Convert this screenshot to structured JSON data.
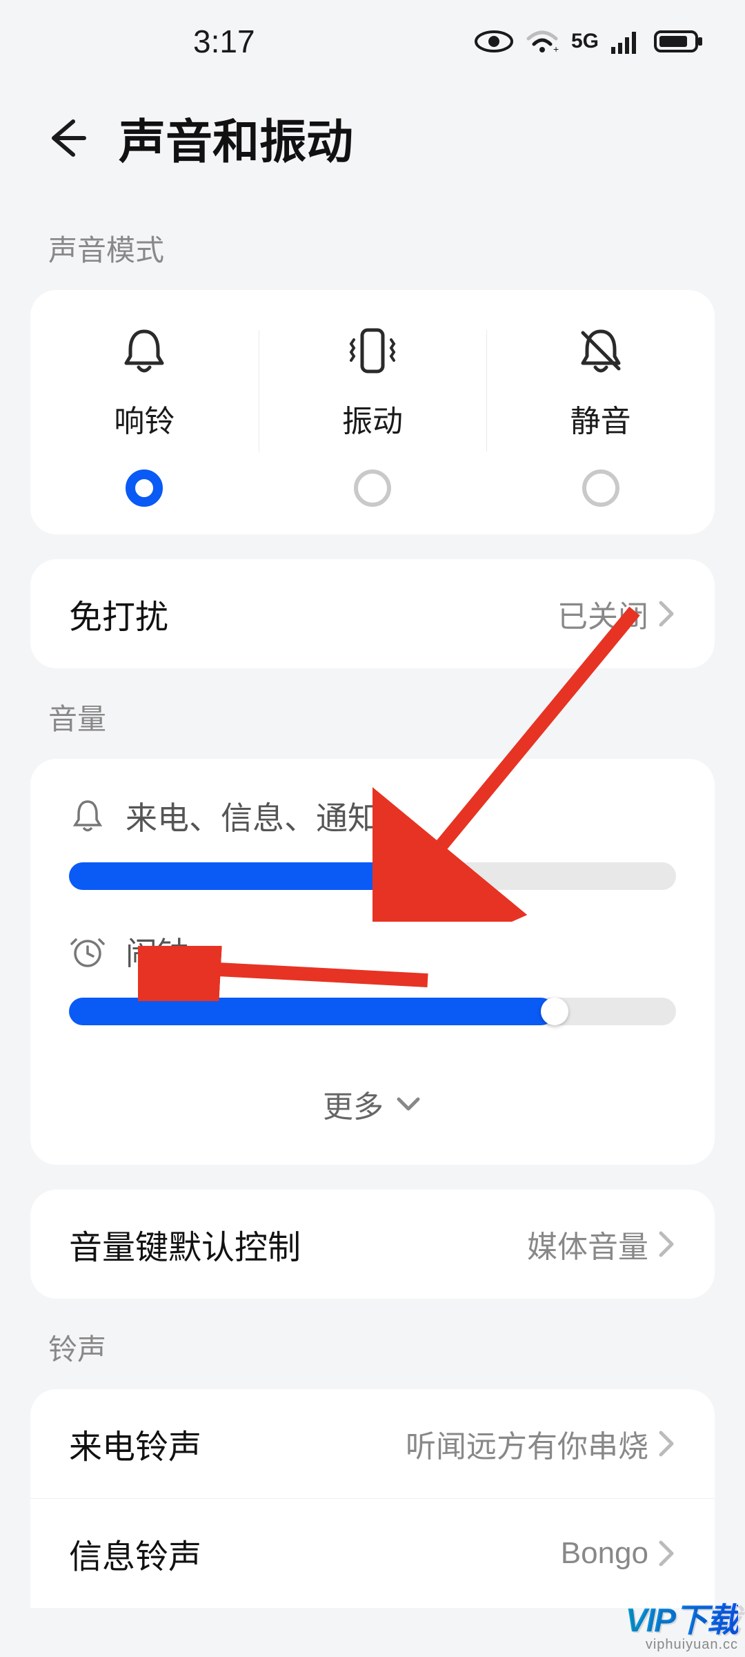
{
  "status": {
    "time": "3:17",
    "network": "5G"
  },
  "header": {
    "title": "声音和振动"
  },
  "sections": {
    "sound_mode_label": "声音模式",
    "volume_label": "音量",
    "ringtone_label": "铃声"
  },
  "sound_mode": {
    "options": [
      {
        "label": "响铃",
        "selected": true
      },
      {
        "label": "振动",
        "selected": false
      },
      {
        "label": "静音",
        "selected": false
      }
    ]
  },
  "dnd": {
    "title": "免打扰",
    "value": "已关闭"
  },
  "volume": {
    "sliders": [
      {
        "icon": "bell",
        "label": "来电、信息、通知",
        "value": 56
      },
      {
        "icon": "alarm",
        "label": "闹钟",
        "value": 80
      }
    ],
    "more_label": "更多"
  },
  "volume_key": {
    "title": "音量键默认控制",
    "value": "媒体音量"
  },
  "ringtones": {
    "call": {
      "title": "来电铃声",
      "value": "听闻远方有你串烧"
    },
    "sms": {
      "title": "信息铃声",
      "value": "Bongo"
    }
  },
  "watermark": {
    "brand": "VIP下载",
    "url": "viphuiyuan.cc"
  },
  "colors": {
    "accent": "#0a5af5",
    "arrow": "#e73323"
  }
}
